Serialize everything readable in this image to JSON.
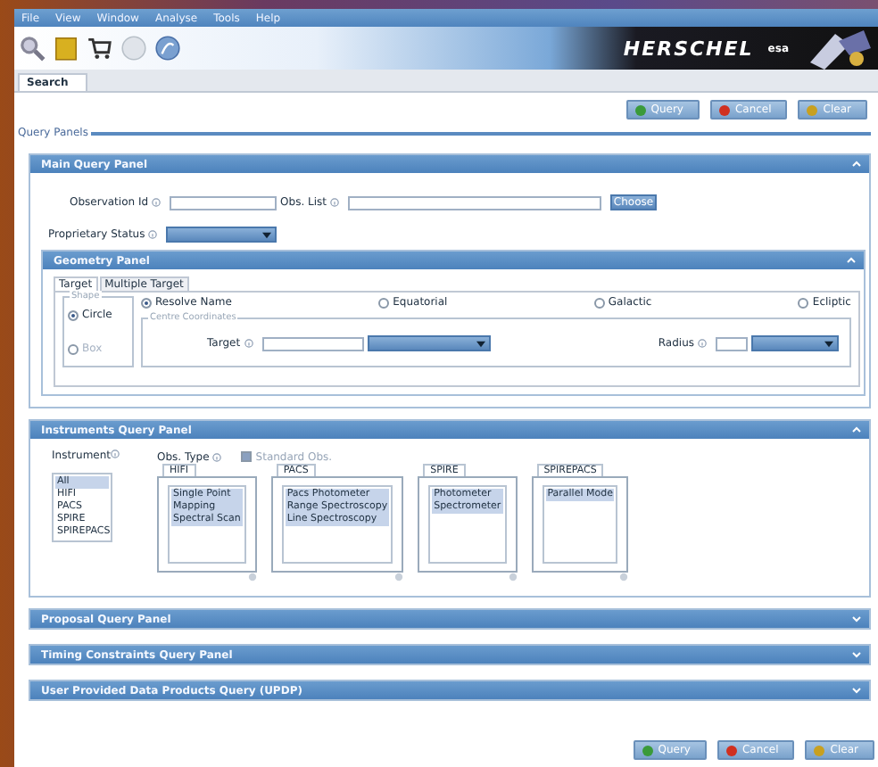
{
  "menu": [
    "File",
    "View",
    "Window",
    "Analyse",
    "Tools",
    "Help"
  ],
  "toolbar": {
    "logo": "HERSCHEL",
    "agency": "esa"
  },
  "tabs": [
    {
      "label": "Search",
      "selected": true
    }
  ],
  "actions": [
    "Query",
    "Cancel",
    "Clear"
  ],
  "query_panels": {
    "legend": "Query Panels",
    "main": {
      "title": "Main Query Panel",
      "observation_id_label": "Observation Id",
      "obs_list_label": "Obs. List",
      "choose_button": "Choose",
      "proprietary_status_label": "Proprietary Status",
      "geometry": {
        "title": "Geometry Panel",
        "tabs": [
          {
            "label": "Target",
            "selected": true
          },
          {
            "label": "Multiple Target",
            "selected": false
          }
        ],
        "shape": {
          "legend": "Shape",
          "options": [
            {
              "label": "Circle",
              "selected": true
            },
            {
              "label": "Box",
              "selected": false
            }
          ]
        },
        "coordinate_systems": [
          {
            "label": "Resolve Name",
            "selected": true
          },
          {
            "label": "Equatorial",
            "selected": false
          },
          {
            "label": "Galactic",
            "selected": false
          },
          {
            "label": "Ecliptic",
            "selected": false
          }
        ],
        "centre": {
          "legend": "Centre Coordinates",
          "target_label": "Target",
          "radius_label": "Radius"
        }
      }
    },
    "instruments": {
      "title": "Instruments Query Panel",
      "instrument_label": "Instrument",
      "instrument_list": [
        {
          "label": "All",
          "selected": true
        },
        {
          "label": "HIFI",
          "selected": false
        },
        {
          "label": "PACS",
          "selected": false
        },
        {
          "label": "SPIRE",
          "selected": false
        },
        {
          "label": "SPIREPACS",
          "selected": false
        }
      ],
      "obs_type_label": "Obs. Type",
      "standard_obs": {
        "label": "Standard Obs.",
        "checked": true
      },
      "groups": [
        {
          "name": "HIFI",
          "items": [
            {
              "label": "Single Point",
              "selected": true
            },
            {
              "label": "Mapping",
              "selected": true
            },
            {
              "label": "Spectral Scan",
              "selected": true
            }
          ]
        },
        {
          "name": "PACS",
          "items": [
            {
              "label": "Pacs Photometer",
              "selected": true
            },
            {
              "label": "Range Spectroscopy",
              "selected": true
            },
            {
              "label": "Line Spectroscopy",
              "selected": true
            }
          ]
        },
        {
          "name": "SPIRE",
          "items": [
            {
              "label": "Photometer",
              "selected": true
            },
            {
              "label": "Spectrometer",
              "selected": true
            }
          ]
        },
        {
          "name": "SPIREPACS",
          "items": [
            {
              "label": "Parallel Mode",
              "selected": true
            }
          ]
        }
      ]
    },
    "collapsed_panels": [
      "Proposal Query Panel",
      "Timing Constraints Query Panel",
      "User Provided Data Products Query (UPDP)"
    ]
  },
  "bottom_actions": [
    "Query",
    "Cancel",
    "Clear"
  ]
}
